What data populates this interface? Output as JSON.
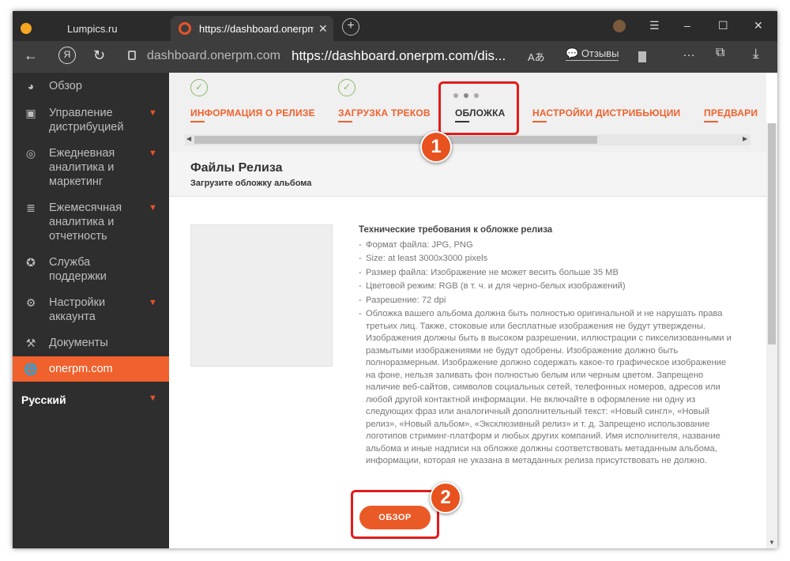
{
  "browser": {
    "tabs": [
      {
        "label": "Lumpics.ru"
      },
      {
        "label": "https://dashboard.onerpm.com"
      }
    ],
    "new_tab": "+",
    "controls": {
      "menu": "☰",
      "minimize": "–",
      "maximize": "☐",
      "close": "✕"
    },
    "address": {
      "domain": "dashboard.onerpm.com",
      "url": "https://dashboard.onerpm.com/dis...",
      "reviews": "Отзывы"
    },
    "icon_names": [
      "back-icon",
      "yandex-icon",
      "reload-icon",
      "lock-icon",
      "translate-icon",
      "bookmark-icon",
      "more-icon",
      "extensions-icon",
      "download-icon"
    ]
  },
  "sidebar": {
    "items": [
      {
        "label": "Обзор",
        "icon": "dashboard-icon"
      },
      {
        "label": "Управление дистрибуцией",
        "icon": "distribution-icon",
        "expandable": true
      },
      {
        "label": "Ежедневная аналитика и маркетинг",
        "icon": "analytics-icon",
        "expandable": true
      },
      {
        "label": "Ежемесячная аналитика и отчетность",
        "icon": "coins-icon",
        "expandable": true
      },
      {
        "label": "Служба поддержки",
        "icon": "support-icon"
      },
      {
        "label": "Настройки аккаунта",
        "icon": "gear-icon",
        "expandable": true
      },
      {
        "label": "Документы",
        "icon": "gavel-icon"
      },
      {
        "label": "onerpm.com",
        "icon": "globe-icon",
        "active": true
      }
    ],
    "language": "Русский"
  },
  "steps": [
    {
      "label": "ИНФОРМАЦИЯ О РЕЛИЗЕ",
      "done": true
    },
    {
      "label": "ЗАГРУЗКА ТРЕКОВ",
      "done": true
    },
    {
      "label": "ОБЛОЖКА",
      "current": true
    },
    {
      "label": "НАСТРОЙКИ ДИСТРИБЬЮЦИИ"
    },
    {
      "label": "ПРЕДВАРИ"
    }
  ],
  "files": {
    "title": "Файлы Релиза",
    "subtitle": "Загрузите обложку альбома"
  },
  "requirements": {
    "title": "Технические требования к обложке релиза",
    "items": [
      "Формат файла: JPG, PNG",
      "Size: at least 3000x3000 pixels",
      "Размер файла: Изображение не может весить больше 35 MB",
      "Цветовой режим: RGB (в т. ч. и для черно-белых изображений)",
      "Разрешение: 72 dpi",
      "Обложка вашего альбома должна быть полностью оригинальной и не нарушать права третьих лиц. Также, стоковые или бесплатные изображения не будут утверждены. Изображения должны быть в высоком разрешении, иллюстрации с пикселизованными и размытыми изображениями не будут одобрены. Изображение должно быть полноразмерным. Изображение должно содержать какое-то графическое изображение на фоне, нельзя заливать фон полностью белым или черным цветом. Запрещено наличие веб-сайтов, символов социальных сетей, телефонных номеров, адресов или любой другой контактной информации. Не включайте в оформление ни одну из следующих фраз или аналогичный дополнительный текст: «Новый сингл», «Новый релиз», «Новый альбом», «Эксклюзивный релиз» и т. д. Запрещено использование логотипов стриминг-платформ и любых других компаний. Имя исполнителя, название альбома и иные надписи на обложке должны соответствовать метаданным альбома, информации, которая не указана в метаданных релиза присутствовать не должно."
    ]
  },
  "browse_button": "ОБЗОР",
  "annotations": {
    "first": "1",
    "second": "2"
  },
  "colors": {
    "accent": "#f0612d",
    "highlight": "#e31b1b",
    "sidebar_bg": "#2e2e2e"
  }
}
